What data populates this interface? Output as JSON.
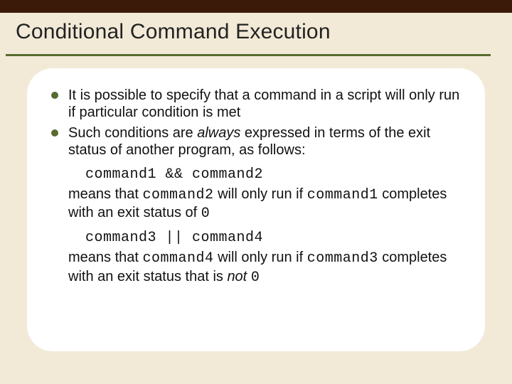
{
  "slide": {
    "title": "Conditional Command Execution",
    "bullets": [
      {
        "pre": "It is possible to specify that a command in a script will only run if particular condition is met"
      },
      {
        "pre": "Such conditions are ",
        "em": "always",
        "post": " expressed in terms of the exit status of another program, as follows:"
      }
    ],
    "code1": "command1 && command2",
    "explain1": {
      "t1": "means that ",
      "c1": "command2",
      "t2": " will only run if ",
      "c2": "command1",
      "t3": " completes with an exit status of ",
      "c3": "0"
    },
    "code2": "command3 || command4",
    "explain2": {
      "t1": "means that ",
      "c1": "command4",
      "t2": " will only run if ",
      "c2": "command3",
      "t3": " completes with an exit status that is ",
      "em": "not",
      "sp": " ",
      "c3": "0"
    }
  }
}
